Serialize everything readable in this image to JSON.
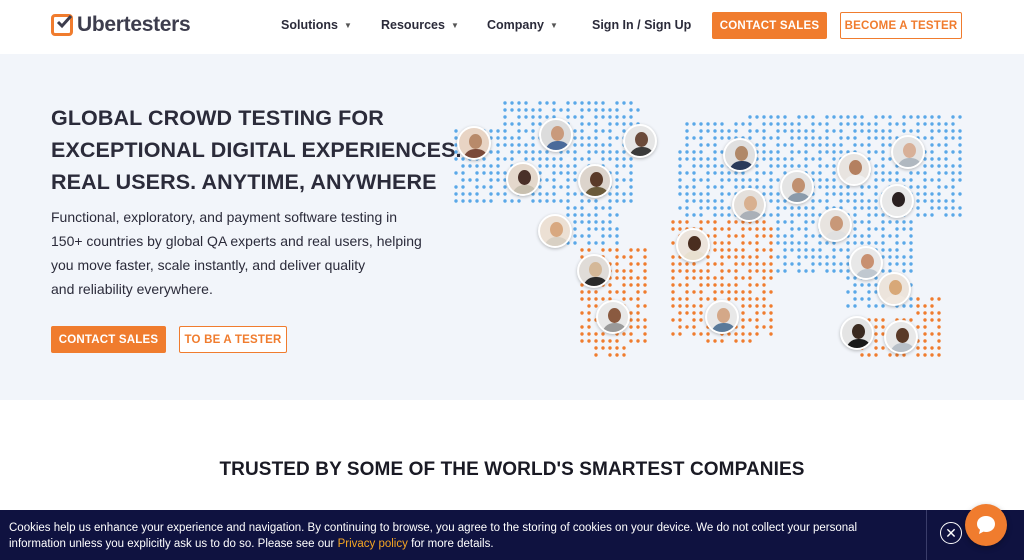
{
  "brand": {
    "name": "Ubertesters",
    "accent": "#f07c2e",
    "dark": "#0f1240"
  },
  "nav": {
    "items": [
      {
        "label": "Solutions",
        "has_caret": true
      },
      {
        "label": "Resources",
        "has_caret": true
      },
      {
        "label": "Company",
        "has_caret": true
      },
      {
        "label": "Sign In / Sign Up",
        "has_caret": false
      }
    ],
    "contact_label": "CONTACT SALES",
    "tester_label": "BECOME A TESTER"
  },
  "hero": {
    "title_lines": [
      "GLOBAL CROWD TESTING FOR",
      "EXCEPTIONAL DIGITAL EXPERIENCES.",
      "REAL USERS. ANYTIME, ANYWHERE"
    ],
    "desc_lines": [
      "Functional, exploratory, and payment software testing in",
      "150+ countries by global QA experts and real users, helping",
      "you move faster, scale instantly, and deliver quality",
      "and reliability everywhere."
    ],
    "contact_label": "CONTACT SALES",
    "tester_label": "TO BE A TESTER",
    "map_colors": {
      "north": "#5aa8e8",
      "south": "#f07c2e"
    }
  },
  "trusted": {
    "title": "TRUSTED BY SOME OF THE WORLD'S SMARTEST COMPANIES"
  },
  "cookie": {
    "text_before": "Cookies help us enhance your experience and navigation. By continuing to browse, you agree to the storing of cookies on your device. We do not collect your personal information unless you explicitly ask us to do so. Please see our ",
    "link_label": "Privacy policy",
    "text_after": " for more details."
  },
  "icons": {
    "close": "close-icon",
    "chat": "chat-icon",
    "logo": "logo-check-icon",
    "caret": "chevron-down-icon"
  }
}
